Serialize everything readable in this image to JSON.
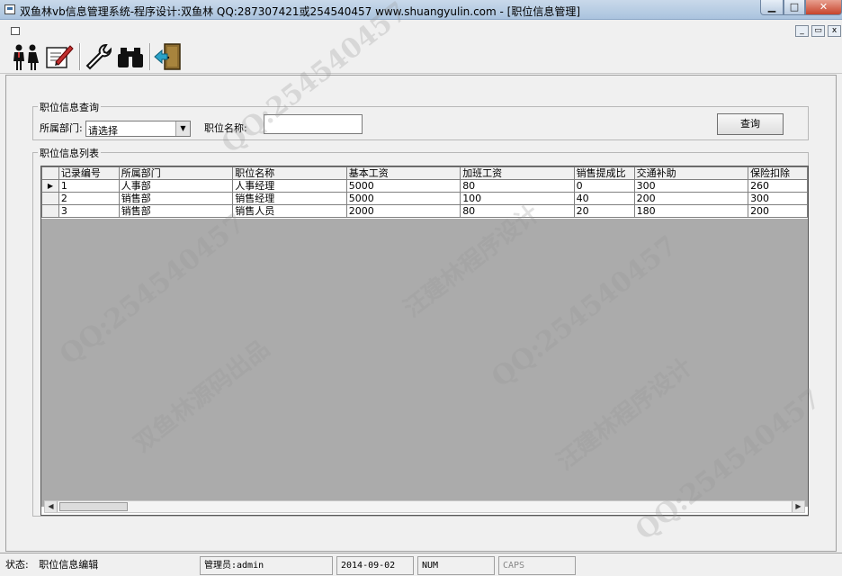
{
  "window": {
    "title": "双鱼林vb信息管理系统-程序设计:双鱼林 QQ:287307421或254540457 www.shuangyulin.com - [职位信息管理]",
    "min_label": "▁",
    "max_label": "□",
    "close_label": "✕"
  },
  "mdi": {
    "min_label": "_",
    "restore_label": "▭",
    "close_label": "x"
  },
  "toolbar": {
    "buttons": [
      {
        "name": "users-icon"
      },
      {
        "name": "edit-notes-icon"
      },
      {
        "name": "wrench-icon"
      },
      {
        "name": "binoculars-icon"
      },
      {
        "name": "exit-door-icon"
      }
    ]
  },
  "query": {
    "group_title": "职位信息查询",
    "department_label": "所属部门:",
    "department_value": "请选择",
    "position_label": "职位名称:",
    "position_value": "",
    "query_button": "查询"
  },
  "list": {
    "group_title": "职位信息列表",
    "columns": [
      "记录编号",
      "所属部门",
      "职位名称",
      "基本工资",
      "加班工资",
      "销售提成比",
      "交通补助",
      "保险扣除"
    ],
    "rows": [
      {
        "cells": [
          "1",
          "人事部",
          "人事经理",
          "5000",
          "80",
          "0",
          "300",
          "260"
        ],
        "selected": true
      },
      {
        "cells": [
          "2",
          "销售部",
          "销售经理",
          "5000",
          "100",
          "40",
          "200",
          "300"
        ],
        "selected": false
      },
      {
        "cells": [
          "3",
          "销售部",
          "销售人员",
          "2000",
          "80",
          "20",
          "180",
          "200"
        ],
        "selected": false
      }
    ],
    "row_indicator": "▶",
    "scroll_left": "◀",
    "scroll_right": "▶"
  },
  "status": {
    "state_label": "状态:",
    "state_value": "职位信息编辑",
    "admin": "管理员:admin",
    "date": "2014-09-02",
    "num": "NUM",
    "caps": "CAPS"
  },
  "watermark": {
    "qq": "QQ:254540457",
    "text1": "双鱼林源码出品",
    "text2": "汪建林程序设计"
  }
}
